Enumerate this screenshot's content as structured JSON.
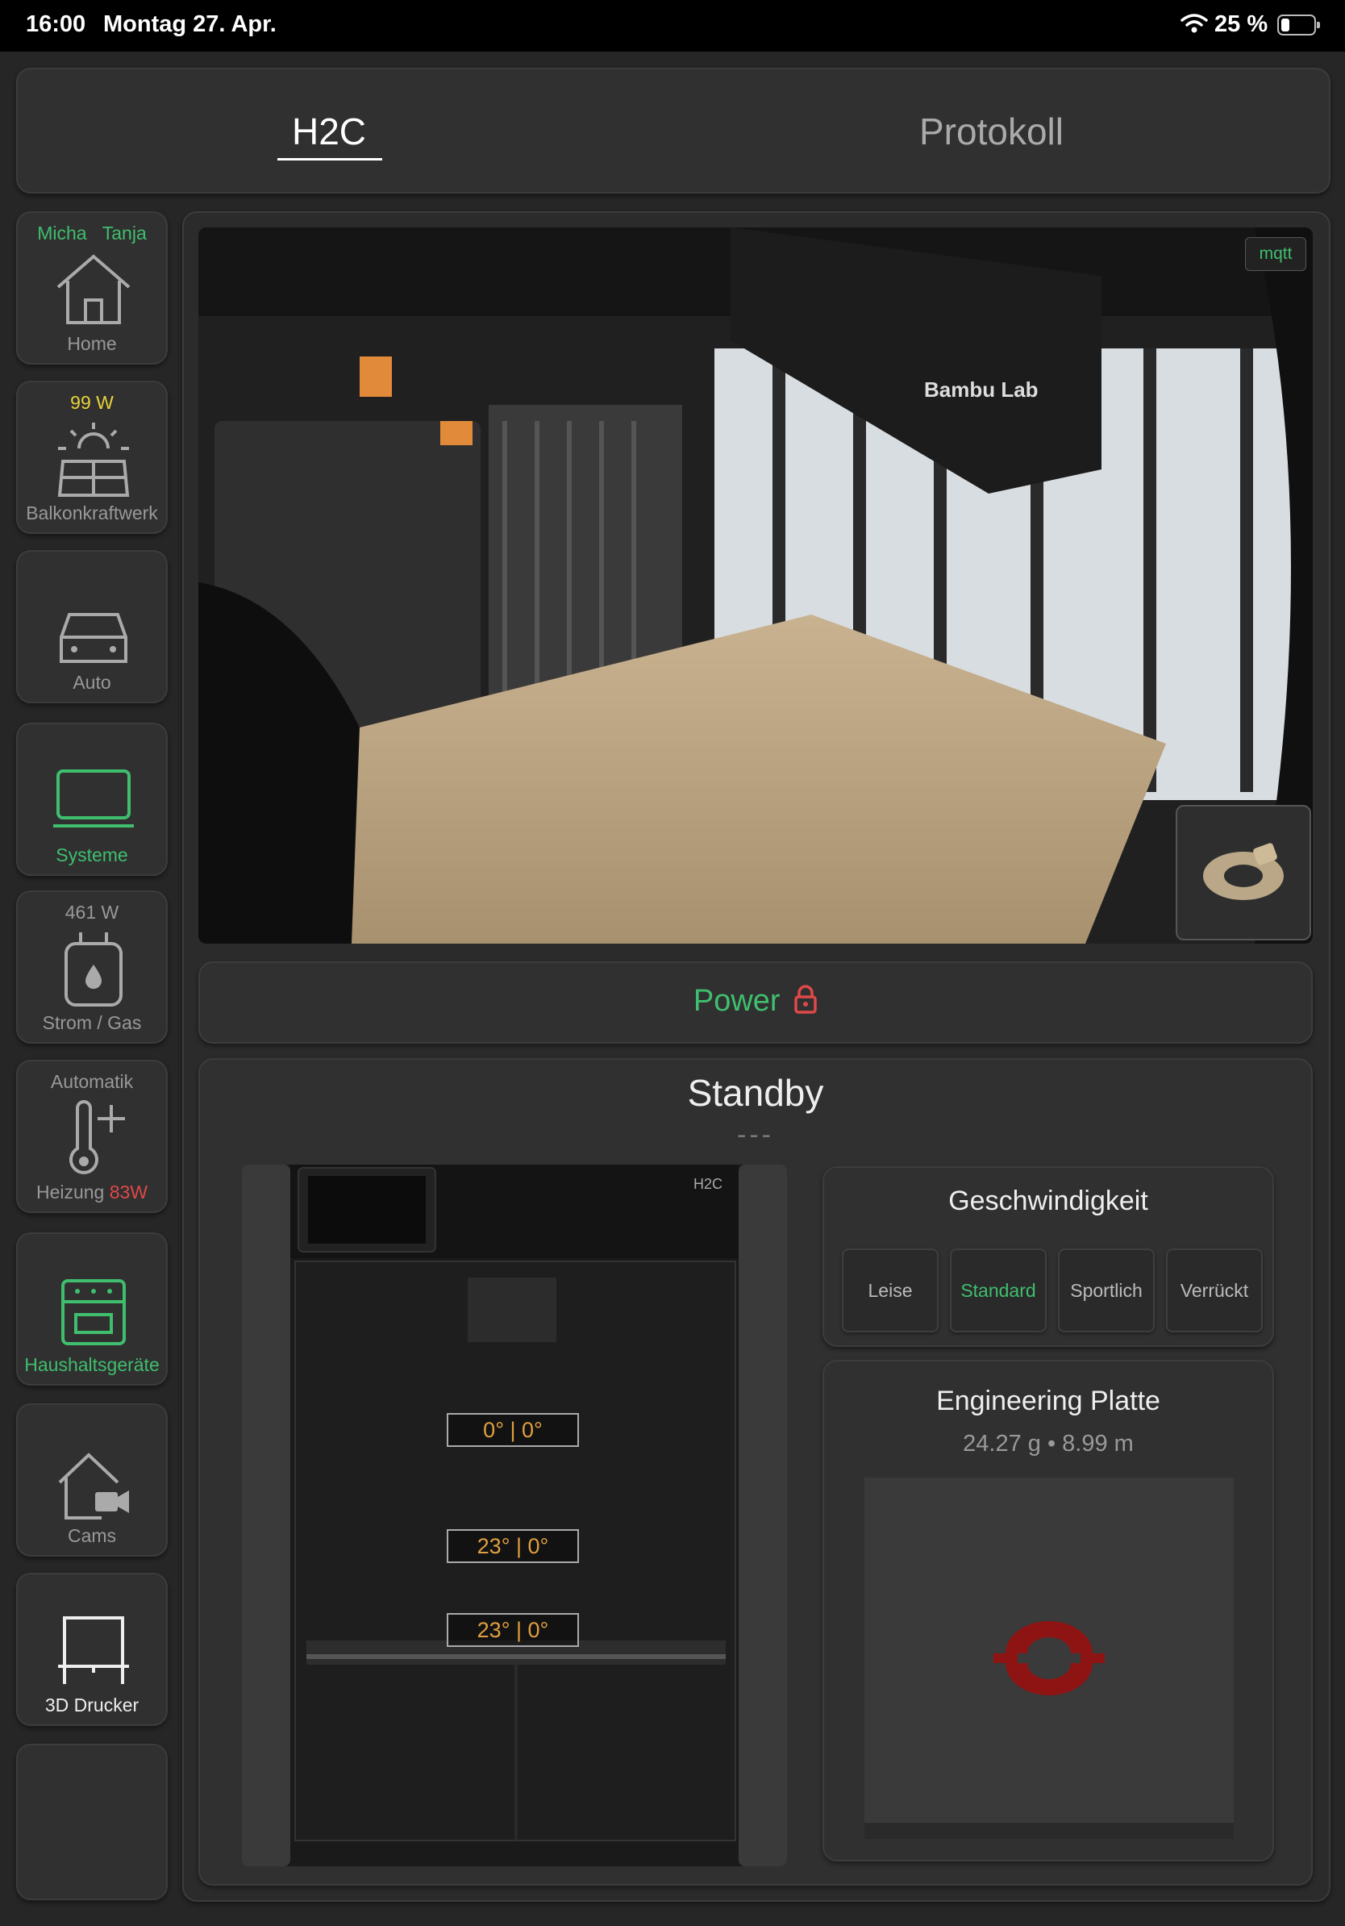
{
  "status_bar": {
    "time": "16:00",
    "date": "Montag 27. Apr.",
    "battery": "25 %"
  },
  "tabs": [
    {
      "label": "H2C"
    },
    {
      "label": "Protokoll"
    }
  ],
  "sidebar": {
    "home": {
      "user1": "Micha",
      "user2": "Tanja",
      "label": "Home"
    },
    "balkon": {
      "value": "99 W",
      "label": "Balkonkraftwerk"
    },
    "auto": {
      "label": "Auto"
    },
    "systeme": {
      "label": "Systeme"
    },
    "strom": {
      "value": "461 W",
      "label": "Strom / Gas"
    },
    "heizung": {
      "top": "Automatik",
      "label": "Heizung",
      "value": "83W"
    },
    "haushalt": {
      "label": "Haushaltsgeräte"
    },
    "cams": {
      "label": "Cams"
    },
    "drucker": {
      "label": "3D Drucker"
    }
  },
  "camera": {
    "badge": "mqtt"
  },
  "power": {
    "label": "Power"
  },
  "printer_status": {
    "state": "Standby",
    "sub": "---",
    "temps": [
      "0° | 0°",
      "23° | 0°",
      "23° | 0°"
    ]
  },
  "speed": {
    "title": "Geschwindigkeit",
    "options": [
      "Leise",
      "Standard",
      "Sportlich",
      "Verrückt"
    ],
    "selected": "Standard"
  },
  "plate": {
    "title": "Engineering Platte",
    "meta": "24.27 g • 8.99 m"
  },
  "colors": {
    "accent_green": "#3fbe6e",
    "warn_red": "#e04848",
    "temp_orange": "#e0a040",
    "power_yellow": "#e8d23a"
  }
}
